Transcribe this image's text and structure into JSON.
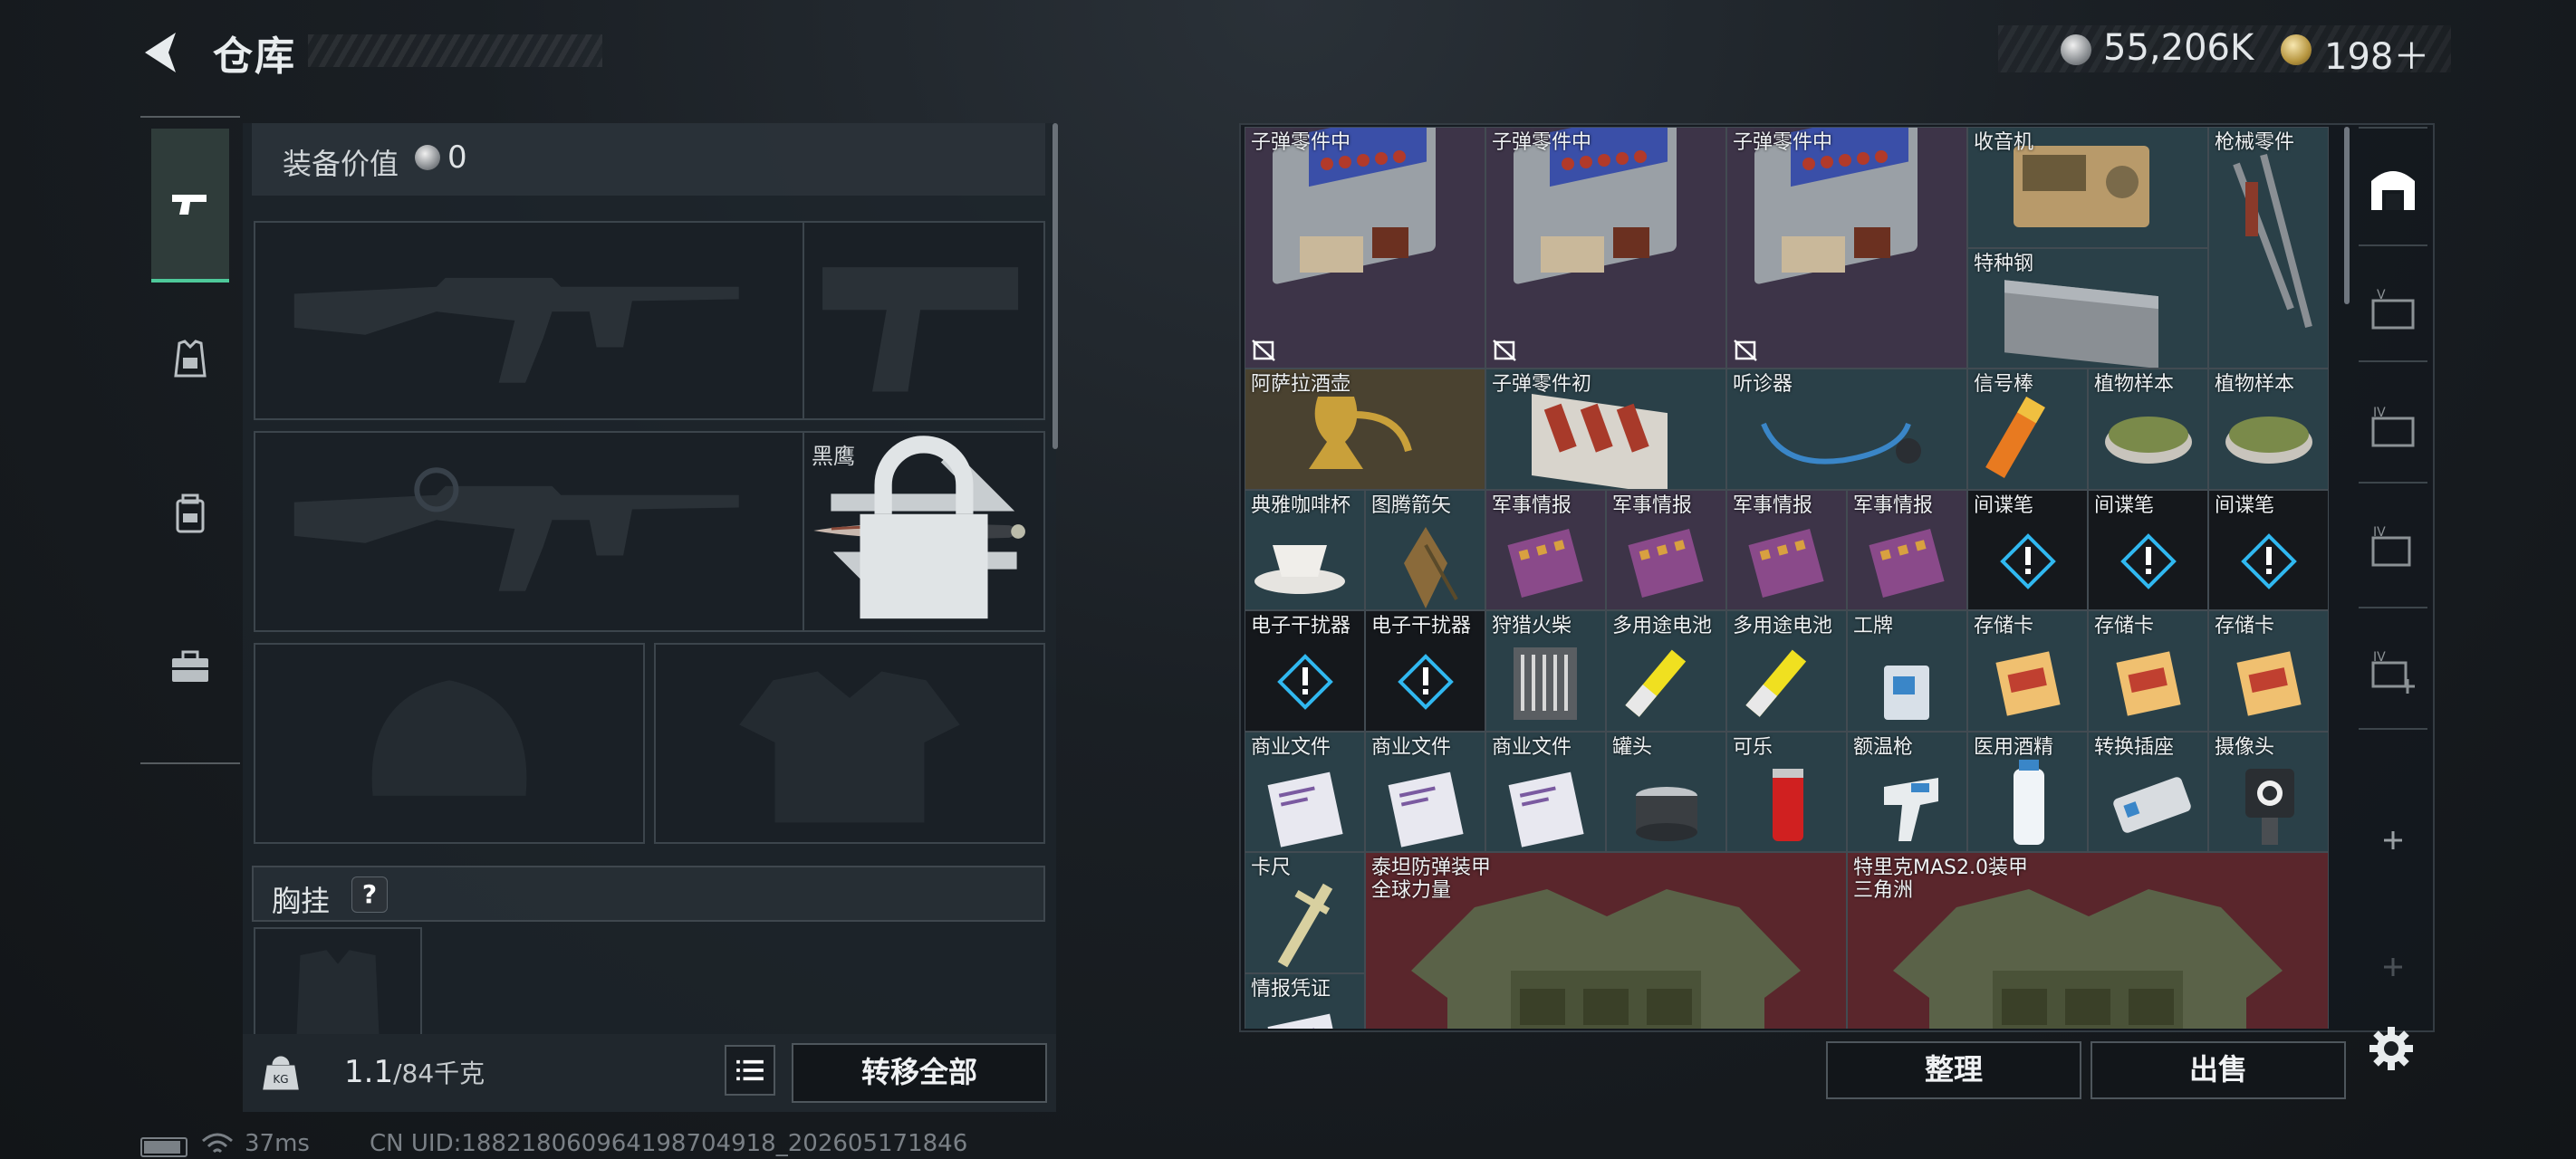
{
  "header": {
    "title": "仓库"
  },
  "currency": {
    "money": "55,206K",
    "points": "198＋"
  },
  "equipment": {
    "value_label": "装备价值",
    "value": "0",
    "melee_name": "黑鹰",
    "chest_rig_label": "胸挂",
    "chest_rig_help": "?"
  },
  "weight": {
    "current": "1.1",
    "max": "/84千克"
  },
  "buttons": {
    "transfer_all": "转移全部",
    "sort": "整理",
    "sell": "出售"
  },
  "status": {
    "ping": "37ms",
    "uid": "CN UID:1882180609641987049​18_202605171846"
  },
  "storage": {
    "items": [
      {
        "name": "子弹零件中"
      },
      {
        "name": "子弹零件中"
      },
      {
        "name": "子弹零件中"
      },
      {
        "name": "收音机"
      },
      {
        "name": "枪械零件"
      },
      {
        "name": "特种钢"
      },
      {
        "name": "阿萨拉酒壶"
      },
      {
        "name": "子弹零件初"
      },
      {
        "name": "听诊器"
      },
      {
        "name": "信号棒"
      },
      {
        "name": "植物样本"
      },
      {
        "name": "植物样本"
      },
      {
        "name": "典雅咖啡杯"
      },
      {
        "name": "图腾箭矢"
      },
      {
        "name": "军事情报"
      },
      {
        "name": "军事情报"
      },
      {
        "name": "军事情报"
      },
      {
        "name": "军事情报"
      },
      {
        "name": "间谍笔"
      },
      {
        "name": "间谍笔"
      },
      {
        "name": "间谍笔"
      },
      {
        "name": "电子干扰器"
      },
      {
        "name": "电子干扰器"
      },
      {
        "name": "狩猎火柴"
      },
      {
        "name": "多用途电池"
      },
      {
        "name": "多用途电池"
      },
      {
        "name": "工牌"
      },
      {
        "name": "存储卡"
      },
      {
        "name": "存储卡"
      },
      {
        "name": "存储卡"
      },
      {
        "name": "商业文件"
      },
      {
        "name": "商业文件"
      },
      {
        "name": "商业文件"
      },
      {
        "name": "罐头"
      },
      {
        "name": "可乐"
      },
      {
        "name": "额温枪"
      },
      {
        "name": "医用酒精"
      },
      {
        "name": "转换插座"
      },
      {
        "name": "摄像头"
      },
      {
        "name": "卡尺"
      },
      {
        "name": "泰坦防弹装甲\n全球力量"
      },
      {
        "name": "特里克MAS2.0装甲\n三角洲"
      },
      {
        "name": "情报凭证"
      }
    ]
  },
  "colors": {
    "rarity_purple": "#3d3448",
    "rarity_blue": "#2a4048",
    "rarity_gold": "#4a4230",
    "rarity_red": "#5a262c",
    "rarity_dark": "#15181c",
    "accent_green": "#4ec99a"
  }
}
